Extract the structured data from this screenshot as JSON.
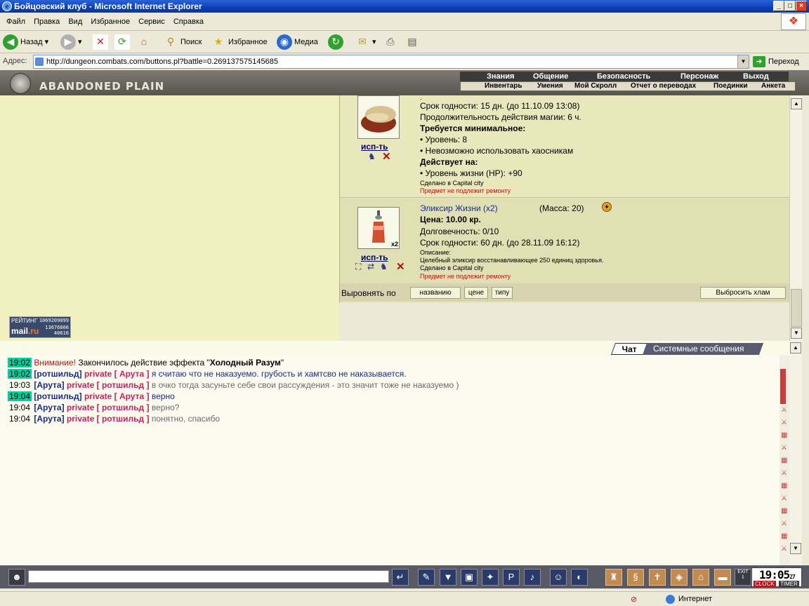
{
  "window": {
    "title": "Бойцовский клуб - Microsoft Internet Explorer",
    "min": "_",
    "max": "□",
    "close": "×"
  },
  "menu": [
    "Файл",
    "Правка",
    "Вид",
    "Избранное",
    "Сервис",
    "Справка"
  ],
  "toolbar": {
    "back": "Назад",
    "search": "Поиск",
    "favorites": "Избранное",
    "media": "Медиа"
  },
  "address": {
    "label": "Адрес:",
    "url": "http://dungeon.combats.com/buttons.pl?battle=0.269137575145685",
    "go": "Переход"
  },
  "game": {
    "location": "ABANDONED PLAIN",
    "nav_top": [
      "Знания",
      "Общение",
      "Безопасность",
      "Персонаж",
      "Выход"
    ],
    "nav_bottom": [
      "Инвентарь",
      "Умения",
      "Мой Скролл",
      "Отчет о переводах",
      "Поединки",
      "Анкета"
    ]
  },
  "rating": {
    "label": "РЕЙТИНГ",
    "brand_a": "mail",
    "brand_b": ".ru",
    "n1": "1069209099",
    "n2": "13676806",
    "n3": "40616"
  },
  "item1": {
    "use": "исп-ть",
    "lines": {
      "dot": "·",
      "expiry": "Срок годности: 15 дн. (до 11.10.09 13:08)",
      "duration": "Продолжительность действия магии: 6 ч.",
      "req_title": "Требуется минимальное:",
      "req1": "• Уровень: 8",
      "req2": "• Невозможно использовать хаосникам",
      "acts_title": "Действует на:",
      "act1": "• Уровень жизни (HP): +90",
      "made": "Сделано в Capital city",
      "norepair": "Предмет не подлежит ремонту"
    }
  },
  "item2": {
    "use": "исп-ть",
    "badge": "x2",
    "name": "Эликсир Жизни (x2)",
    "mass": "(Масса: 20)",
    "price": "Цена: 10.00 кр.",
    "durability": "Долговечность: 0/10",
    "expiry": "Срок годности: 60 дн. (до 28.11.09 16:12)",
    "desc_title": "Описание:",
    "desc": "Целебный эликсир восстанавливающее 250 единиц здоровья.",
    "made": "Сделано в Capital city",
    "norepair": "Предмет не подлежит ремонту"
  },
  "sort": {
    "label": "Выровнять по",
    "by_name": "названию",
    "by_price": "цене",
    "by_type": "типу",
    "drop": "Выбросить хлам"
  },
  "tabs": {
    "chat": "Чат",
    "system": "Системные сообщения"
  },
  "chat": [
    {
      "time": "19:02",
      "hl": true,
      "warn": "Внимание!",
      "text": " Закончилось действие эффекта \"",
      "bold": "Холодный Разум",
      "end": "\""
    },
    {
      "time": "19:02",
      "hl": true,
      "from": "[ротшильд]",
      "priv": "private [ Арута ]",
      "msg": "я считаю что не наказуемо. грубость и хамтсво не наказывается.",
      "own": true
    },
    {
      "time": "19:03",
      "hl": false,
      "from": "[Арута]",
      "priv": "private [ ротшильд ]",
      "msg": "в очко тогда засуньте себе свои рассуждения - это значит тоже не наказуемо )",
      "own": false
    },
    {
      "time": "19:04",
      "hl": true,
      "from": "[ротшильд]",
      "priv": "private [ Арута ]",
      "msg": "верно",
      "own": true
    },
    {
      "time": "19:04",
      "hl": false,
      "from": "[Арута]",
      "priv": "private [ ротшильд ]",
      "msg": "верно?",
      "own": false
    },
    {
      "time": "19:04",
      "hl": false,
      "from": "[Арута]",
      "priv": "private [ ротшильд ]",
      "msg": "понятно, спасибо",
      "own": false
    }
  ],
  "clock": {
    "time": "19:05",
    "sec": "27",
    "clock_label": "CLOCK",
    "timer_label": "TIMER",
    "exit": "EXIT"
  },
  "status": {
    "zone": "Интернет"
  },
  "colors": {
    "accent": "#0a3fb8",
    "panel": "#e6e6b8",
    "timestamp_hl": "#00d0a0",
    "private": "#d0205a"
  }
}
